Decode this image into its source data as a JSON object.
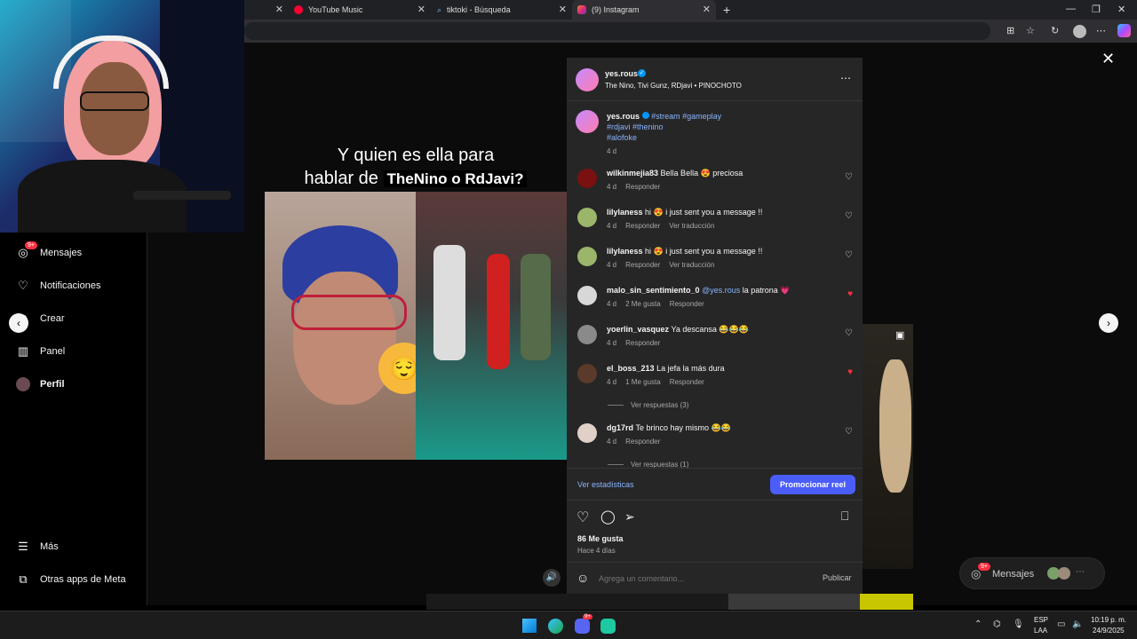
{
  "browser": {
    "tabs": [
      {
        "label": "YouTube Music",
        "icon": "youtube-music-icon"
      },
      {
        "label": "tiktoki - Búsqueda",
        "icon": "search-icon"
      },
      {
        "label": "(9) Instagram",
        "icon": "instagram-icon"
      }
    ],
    "new_tab": "+"
  },
  "sidebar": {
    "items": [
      {
        "label": "Mensajes",
        "icon": "messenger-icon",
        "badge": "9+"
      },
      {
        "label": "Notificaciones",
        "icon": "heart-icon"
      },
      {
        "label": "Crear",
        "icon": "plus-icon"
      },
      {
        "label": "Panel",
        "icon": "chart-icon"
      },
      {
        "label": "Perfil",
        "icon": "avatar"
      }
    ],
    "bottom": [
      {
        "label": "Más",
        "icon": "menu-icon"
      },
      {
        "label": "Otras apps de Meta",
        "icon": "apps-icon"
      }
    ]
  },
  "video": {
    "caption_line1": "Y quien es ella para",
    "caption_line2a": "hablar de",
    "caption_line2b": "TheNino o RdJavi?"
  },
  "post": {
    "author": "yes.rous",
    "audio": "The Nino, Tivi Gunz, RDjavi • PINOCHOTO",
    "caption_user": "yes.rous",
    "caption_tags_1": "#stream #gameplay",
    "caption_tags_2": "#rdjavi #thenino",
    "caption_tags_3": "#alofoke",
    "caption_time": "4 d",
    "comments": [
      {
        "user": "wilkinmejia83",
        "text": "Bella Bella 😍 preciosa",
        "time": "4 d",
        "likes": "",
        "reply": "Responder",
        "translate": "",
        "liked": false
      },
      {
        "user": "lilylaness",
        "text": "hi 😍 i just sent you a message !!",
        "time": "4 d",
        "likes": "",
        "reply": "Responder",
        "translate": "Ver traducción",
        "liked": false
      },
      {
        "user": "lilylaness",
        "text": "hi 😍 i just sent you a message !!",
        "time": "4 d",
        "likes": "",
        "reply": "Responder",
        "translate": "Ver traducción",
        "liked": false
      },
      {
        "user": "malo_sin_sentimiento_0",
        "mention": "@yes.rous",
        "text": "la patrona 💗",
        "time": "4 d",
        "likes": "2 Me gusta",
        "reply": "Responder",
        "translate": "",
        "liked": true
      },
      {
        "user": "yoerlin_vasquez",
        "text": "Ya descansa 😂😂😂",
        "time": "4 d",
        "likes": "",
        "reply": "Responder",
        "translate": "",
        "liked": false
      },
      {
        "user": "el_boss_213",
        "text": "La jefa la más dura",
        "time": "4 d",
        "likes": "1 Me gusta",
        "reply": "Responder",
        "translate": "",
        "liked": true
      },
      {
        "user": "dg17rd",
        "text": "Te brinco hay mismo 😂😂",
        "time": "4 d",
        "likes": "",
        "reply": "Responder",
        "translate": "",
        "liked": false
      }
    ],
    "view_replies_1": "Ver respuestas (3)",
    "view_replies_2": "Ver respuestas (1)",
    "stats_link": "Ver estadísticas",
    "promote_button": "Promocionar reel",
    "likes": "86 Me gusta",
    "date": "Hace 4 días",
    "comment_placeholder": "Agrega un comentario...",
    "publish": "Publicar"
  },
  "floating_messages": {
    "label": "Mensajes",
    "badge": "9+"
  },
  "taskbar": {
    "lang_line1": "ESP",
    "lang_line2": "LAA",
    "time": "10:19 p. m.",
    "date": "24/9/2025",
    "discord_badge": "9+"
  },
  "colors": {
    "accent": "#4a5df9",
    "liked": "#ff3040",
    "link": "#8ab4ff",
    "panel_bg": "#262626"
  }
}
